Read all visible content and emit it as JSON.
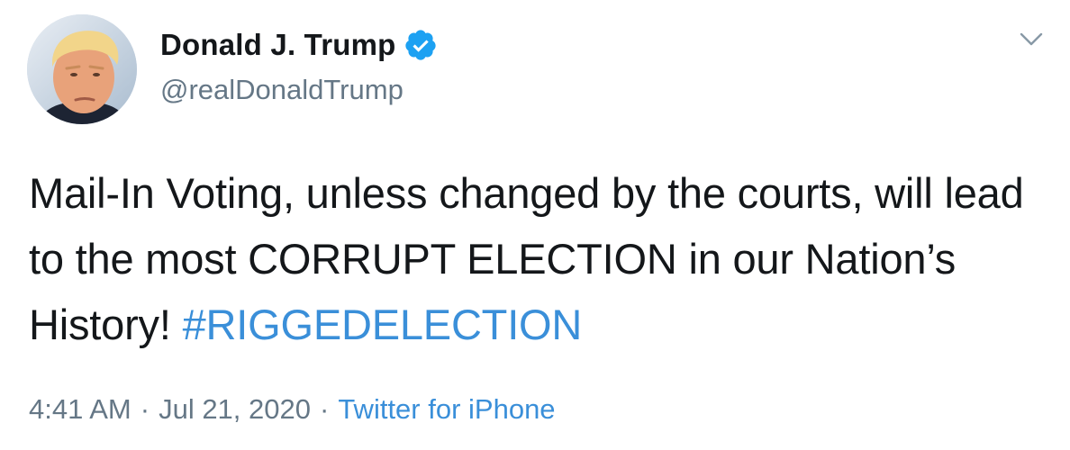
{
  "tweet": {
    "author": {
      "display_name": "Donald J. Trump",
      "handle": "@realDonaldTrump",
      "verified": true
    },
    "text_before_hashtag": "Mail-In Voting, unless changed by the courts, will lead to the most CORRUPT ELECTION in our Nation’s History! ",
    "hashtag": "#RIGGEDELECTION",
    "time": "4:41 AM",
    "separator": "·",
    "date": "Jul 21, 2020",
    "source": "Twitter for iPhone"
  },
  "icons": {
    "verified": "verified-badge-icon",
    "menu": "chevron-down-icon"
  },
  "colors": {
    "link": "#3a8fd9",
    "secondary_text": "#657786",
    "primary_text": "#14171a",
    "verified_badge": "#1da1f2"
  }
}
